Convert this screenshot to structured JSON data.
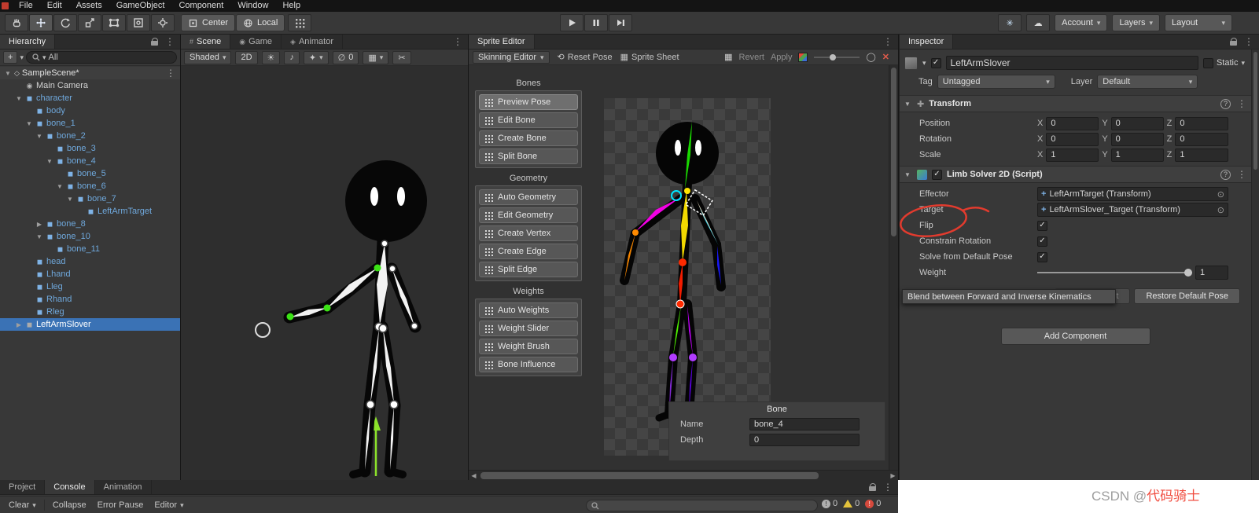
{
  "window": {
    "menu": [
      "File",
      "Edit",
      "Assets",
      "GameObject",
      "Component",
      "Window",
      "Help"
    ],
    "toolbar": {
      "pivot": "Center",
      "space": "Local",
      "account": "Account",
      "layers": "Layers",
      "layout": "Layout"
    }
  },
  "hierarchy": {
    "tab": "Hierarchy",
    "search_value": "All",
    "scene": "SampleScene*",
    "items": [
      {
        "label": "Main Camera",
        "depth": 1,
        "arrow": "",
        "icon": "camera",
        "color": "default"
      },
      {
        "label": "character",
        "depth": 1,
        "arrow": "down",
        "icon": "prefab",
        "color": "prefab"
      },
      {
        "label": "body",
        "depth": 2,
        "arrow": "",
        "icon": "prefab",
        "color": "prefab"
      },
      {
        "label": "bone_1",
        "depth": 2,
        "arrow": "down",
        "icon": "prefab",
        "color": "prefab"
      },
      {
        "label": "bone_2",
        "depth": 3,
        "arrow": "down",
        "icon": "prefab",
        "color": "prefab"
      },
      {
        "label": "bone_3",
        "depth": 4,
        "arrow": "",
        "icon": "prefab",
        "color": "prefab"
      },
      {
        "label": "bone_4",
        "depth": 4,
        "arrow": "down",
        "icon": "prefab",
        "color": "prefab"
      },
      {
        "label": "bone_5",
        "depth": 5,
        "arrow": "",
        "icon": "prefab",
        "color": "prefab"
      },
      {
        "label": "bone_6",
        "depth": 5,
        "arrow": "down",
        "icon": "prefab",
        "color": "prefab"
      },
      {
        "label": "bone_7",
        "depth": 6,
        "arrow": "down",
        "icon": "prefab",
        "color": "prefab"
      },
      {
        "label": "LeftArmTarget",
        "depth": 7,
        "arrow": "",
        "icon": "prefab",
        "color": "prefab"
      },
      {
        "label": "bone_8",
        "depth": 3,
        "arrow": "right",
        "icon": "prefab",
        "color": "prefab"
      },
      {
        "label": "bone_10",
        "depth": 3,
        "arrow": "down",
        "icon": "prefab",
        "color": "prefab"
      },
      {
        "label": "bone_11",
        "depth": 4,
        "arrow": "",
        "icon": "prefab",
        "color": "prefab"
      },
      {
        "label": "head",
        "depth": 2,
        "arrow": "",
        "icon": "prefab",
        "color": "prefab"
      },
      {
        "label": "Lhand",
        "depth": 2,
        "arrow": "",
        "icon": "prefab",
        "color": "prefab"
      },
      {
        "label": "Lleg",
        "depth": 2,
        "arrow": "",
        "icon": "prefab",
        "color": "prefab"
      },
      {
        "label": "Rhand",
        "depth": 2,
        "arrow": "",
        "icon": "prefab",
        "color": "prefab"
      },
      {
        "label": "Rleg",
        "depth": 2,
        "arrow": "",
        "icon": "prefab",
        "color": "prefab"
      },
      {
        "label": "LeftArmSlover",
        "depth": 1,
        "arrow": "right",
        "icon": "gameobject",
        "color": "selected",
        "selected": true
      }
    ]
  },
  "scene_view": {
    "tabs": [
      {
        "label": "Scene",
        "icon": "scene_tab",
        "active": true
      },
      {
        "label": "Game",
        "icon": "game_tab"
      },
      {
        "label": "Animator",
        "icon": "animator_tab"
      }
    ],
    "toolbar": {
      "shading": "Shaded",
      "mode_2d": "2D",
      "hidden_count": "0"
    }
  },
  "sprite_editor": {
    "tab": "Sprite Editor",
    "toolbar": {
      "skinning": "Skinning Editor",
      "reset_pose": "Reset Pose",
      "sprite_sheet": "Sprite Sheet",
      "revert": "Revert",
      "apply": "Apply"
    },
    "groups": [
      {
        "title": "Bones",
        "buttons": [
          {
            "label": "Preview Pose",
            "active": true
          },
          {
            "label": "Edit Bone"
          },
          {
            "label": "Create Bone"
          },
          {
            "label": "Split Bone"
          }
        ]
      },
      {
        "title": "Geometry",
        "buttons": [
          {
            "label": "Auto Geometry"
          },
          {
            "label": "Edit Geometry"
          },
          {
            "label": "Create Vertex"
          },
          {
            "label": "Create Edge"
          },
          {
            "label": "Split Edge"
          }
        ]
      },
      {
        "title": "Weights",
        "buttons": [
          {
            "label": "Auto Weights"
          },
          {
            "label": "Weight Slider"
          },
          {
            "label": "Weight Brush"
          },
          {
            "label": "Bone Influence"
          }
        ]
      }
    ],
    "bone_panel": {
      "title": "Bone",
      "name_label": "Name",
      "name_value": "bone_4",
      "depth_label": "Depth",
      "depth_value": "0"
    }
  },
  "inspector": {
    "tab": "Inspector",
    "object_name": "LeftArmSlover",
    "static_label": "Static",
    "tag_label": "Tag",
    "tag_value": "Untagged",
    "layer_label": "Layer",
    "layer_value": "Default",
    "transform": {
      "title": "Transform",
      "axis_labels": [
        "X",
        "Y",
        "Z"
      ],
      "rows": [
        {
          "label": "Position",
          "x": "0",
          "y": "0",
          "z": "0"
        },
        {
          "label": "Rotation",
          "x": "0",
          "y": "0",
          "z": "0"
        },
        {
          "label": "Scale",
          "x": "1",
          "y": "1",
          "z": "1"
        }
      ]
    },
    "limb_solver": {
      "title": "Limb Solver 2D (Script)",
      "effector_label": "Effector",
      "effector_value": "LeftArmTarget (Transform)",
      "target_label": "Target",
      "target_value": "LeftArmSlover_Target (Transform)",
      "flip_label": "Flip",
      "flip_checked": true,
      "constrain_label": "Constrain Rotation",
      "constrain_checked": true,
      "solve_label": "Solve from Default Pose",
      "solve_checked": true,
      "weight_label": "Weight",
      "weight_value": "1",
      "create_target": "Create Target",
      "restore_default": "Restore Default Pose"
    },
    "tooltip": "Blend between Forward and Inverse Kinematics",
    "add_component": "Add Component"
  },
  "bottom": {
    "tabs": [
      {
        "label": "Project"
      },
      {
        "label": "Console",
        "active": true
      },
      {
        "label": "Animation"
      }
    ],
    "console_toolbar": {
      "clear": "Clear",
      "collapse": "Collapse",
      "error_pause": "Error Pause",
      "editor": "Editor"
    },
    "badges": [
      {
        "type": "info",
        "count": "0"
      },
      {
        "type": "warn",
        "count": "0"
      },
      {
        "type": "err",
        "count": "0"
      }
    ]
  },
  "watermark": {
    "prefix": "CSDN @",
    "name": "代码骑士"
  },
  "icons": {
    "scene_tab": "#",
    "game_tab": "◉",
    "animator_tab": "◈",
    "prefab_cube": "◼",
    "gameobject_cube": "◼",
    "camera": "◉",
    "scene_asset": "◇",
    "foldout_open": "▼",
    "foldout_closed": "▶"
  },
  "colors": {
    "selection": "#3A72B5",
    "prefab_text": "#6FA8DC",
    "annotation": "#E23B2E"
  }
}
